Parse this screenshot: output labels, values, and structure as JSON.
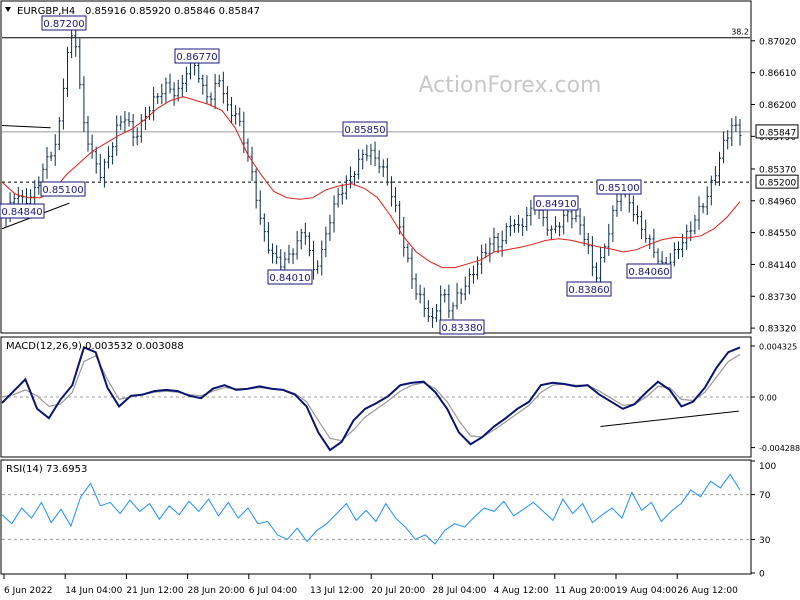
{
  "chart_data": [
    {
      "type": "ohlc",
      "title": "EURGBP,H4",
      "header_values": "0.85916 0.85920 0.85846 0.85847",
      "watermark": "ActionForex.com",
      "ylim": [
        0.8327,
        0.8752
      ],
      "y_ticks": [
        "0.87020",
        "0.86610",
        "0.86200",
        "0.85790",
        "0.85370",
        "0.84960",
        "0.84550",
        "0.84140",
        "0.83730",
        "0.83320"
      ],
      "price_badges": [
        "0.85847",
        "0.85200"
      ],
      "fib_label": "38.2",
      "fib_level": 0.8706,
      "support_level": 0.852,
      "close_level": 0.85847,
      "annotations": [
        {
          "label": "0.87200",
          "value": 0.872
        },
        {
          "label": "0.86770",
          "value": 0.8677
        },
        {
          "label": "0.85850",
          "value": 0.8585
        },
        {
          "label": "0.85100",
          "value": 0.851
        },
        {
          "label": "0.84010",
          "value": 0.8401
        },
        {
          "label": "0.83380",
          "value": 0.8338
        },
        {
          "label": "0.84910",
          "value": 0.8491
        },
        {
          "label": "0.85100",
          "value": 0.851
        },
        {
          "label": "0.83860",
          "value": 0.8386
        },
        {
          "label": "0.84060",
          "value": 0.8406
        },
        {
          "label": "0.84840",
          "value": 0.8484
        }
      ],
      "x_labels": [
        "6 Jun 2022",
        "14 Jun 04:00",
        "21 Jun 12:00",
        "28 Jun 20:00",
        "6 Jul 04:00",
        "13 Jul 12:00",
        "20 Jul 20:00",
        "28 Jul 04:00",
        "4 Aug 12:00",
        "11 Aug 20:00",
        "19 Aug 04:00",
        "26 Aug 12:00"
      ],
      "price_path": [
        0.8475,
        0.8505,
        0.8496,
        0.85,
        0.8525,
        0.8555,
        0.857,
        0.8675,
        0.872,
        0.86,
        0.8558,
        0.853,
        0.8552,
        0.859,
        0.8606,
        0.8575,
        0.8598,
        0.862,
        0.8635,
        0.8645,
        0.863,
        0.866,
        0.8677,
        0.864,
        0.8628,
        0.8655,
        0.8612,
        0.8608,
        0.857,
        0.852,
        0.846,
        0.843,
        0.8415,
        0.8421,
        0.844,
        0.846,
        0.8404,
        0.843,
        0.8475,
        0.8505,
        0.852,
        0.8538,
        0.856,
        0.8555,
        0.854,
        0.8512,
        0.847,
        0.842,
        0.838,
        0.836,
        0.8339,
        0.838,
        0.8355,
        0.8375,
        0.839,
        0.841,
        0.843,
        0.8445,
        0.844,
        0.847,
        0.846,
        0.8475,
        0.8491,
        0.847,
        0.8455,
        0.847,
        0.8482,
        0.847,
        0.8445,
        0.8395,
        0.843,
        0.8475,
        0.851,
        0.8495,
        0.847,
        0.845,
        0.843,
        0.8408,
        0.8422,
        0.844,
        0.8455,
        0.848,
        0.8498,
        0.8528,
        0.8567,
        0.8593,
        0.8585
      ],
      "ma_path": [
        0.852,
        0.8505,
        0.85,
        0.85,
        0.851,
        0.853,
        0.8545,
        0.856,
        0.857,
        0.858,
        0.8588,
        0.86,
        0.8615,
        0.8625,
        0.863,
        0.8625,
        0.862,
        0.8612,
        0.859,
        0.8555,
        0.853,
        0.8508,
        0.85,
        0.8498,
        0.85,
        0.851,
        0.8515,
        0.8518,
        0.8512,
        0.85,
        0.8477,
        0.845,
        0.843,
        0.8418,
        0.841,
        0.841,
        0.8415,
        0.842,
        0.843,
        0.8433,
        0.8436,
        0.844,
        0.8445,
        0.8447,
        0.8445,
        0.8441,
        0.8437,
        0.8434,
        0.843,
        0.8433,
        0.844,
        0.8446,
        0.8449,
        0.8448,
        0.8451,
        0.846,
        0.8475,
        0.8495
      ],
      "triangle_lines": [
        {
          "x0_frac": 0.0,
          "y0": 0.8593,
          "x1_frac": 0.065,
          "y1": 0.859
        },
        {
          "x0_frac": 0.0,
          "y0": 0.846,
          "x1_frac": 0.09,
          "y1": 0.8493
        }
      ]
    },
    {
      "type": "line",
      "title": "MACD(12,26,9) 0.003532 0.003088",
      "ylim": [
        -0.005,
        0.005
      ],
      "y_ticks": [
        "0.004325",
        "0.00",
        "-0.004288"
      ],
      "macd_path": [
        -0.0005,
        0.0005,
        0.0015,
        -0.001,
        -0.0018,
        -0.0002,
        0.001,
        0.0042,
        0.0038,
        0.0008,
        -0.0008,
        0.0001,
        0.0002,
        0.0005,
        0.0006,
        0.0005,
        0.0001,
        -0.0001,
        0.0007,
        0.001,
        0.0006,
        0.0007,
        0.0009,
        0.0007,
        0.0006,
        0.0002,
        -0.0008,
        -0.003,
        -0.0045,
        -0.0038,
        -0.002,
        -0.001,
        -0.0005,
        0.0001,
        0.001,
        0.0012,
        0.0013,
        0.0004,
        -0.001,
        -0.003,
        -0.004,
        -0.0034,
        -0.0025,
        -0.0018,
        -0.001,
        -0.0004,
        0.001,
        0.0012,
        0.0011,
        0.0009,
        0.001,
        0.0002,
        -0.0004,
        -0.001,
        -0.0006,
        0.0004,
        0.0013,
        0.0006,
        -0.0008,
        -0.0004,
        0.0008,
        0.0025,
        0.0038,
        0.0042
      ],
      "signal_path": [
        0.0,
        0.0002,
        0.0006,
        0.0001,
        -0.0008,
        -0.0006,
        0.0004,
        0.003,
        0.0035,
        0.0015,
        -0.0002,
        0.0,
        0.0002,
        0.0004,
        0.0005,
        0.0004,
        0.0002,
        0.0001,
        0.0005,
        0.0008,
        0.0007,
        0.0007,
        0.0008,
        0.0007,
        0.0006,
        0.0003,
        -0.0004,
        -0.002,
        -0.0035,
        -0.0037,
        -0.0028,
        -0.0017,
        -0.001,
        -0.0003,
        0.0005,
        0.001,
        0.0012,
        0.0007,
        -0.0004,
        -0.002,
        -0.0033,
        -0.0034,
        -0.0028,
        -0.0021,
        -0.0014,
        -0.0007,
        0.0004,
        0.001,
        0.0011,
        0.001,
        0.001,
        0.0005,
        -0.0001,
        -0.0007,
        -0.0006,
        0.0,
        0.0009,
        0.0008,
        -0.0002,
        -0.0003,
        0.0004,
        0.0017,
        0.003,
        0.0036
      ],
      "trendline": {
        "x0_frac": 0.8,
        "y0": -0.0025,
        "x1_frac": 0.985,
        "y1": -0.0012
      }
    },
    {
      "type": "line",
      "title": "RSI(14) 73.6953",
      "ylim": [
        0,
        100
      ],
      "y_ticks": [
        "100",
        "70",
        "30",
        "0"
      ],
      "levels": [
        70,
        30
      ],
      "rsi_path": [
        52,
        44,
        58,
        49,
        63,
        45,
        57,
        42,
        68,
        80,
        60,
        63,
        53,
        65,
        55,
        62,
        48,
        60,
        52,
        64,
        55,
        66,
        51,
        63,
        49,
        58,
        44,
        46,
        34,
        30,
        40,
        28,
        38,
        44,
        53,
        62,
        47,
        56,
        46,
        62,
        49,
        41,
        30,
        34,
        26,
        38,
        44,
        41,
        50,
        58,
        55,
        64,
        51,
        57,
        63,
        55,
        47,
        66,
        53,
        62,
        45,
        52,
        58,
        49,
        72,
        56,
        63,
        46,
        55,
        62,
        74,
        68,
        82,
        76,
        88,
        74
      ]
    }
  ]
}
